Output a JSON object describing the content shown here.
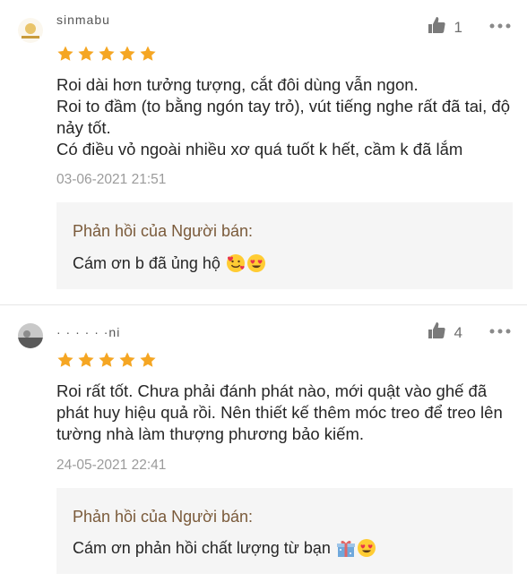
{
  "colors": {
    "star": "#f5a623",
    "reply_title": "#7a5a3a",
    "reply_bg": "#f5f5f5"
  },
  "reviews": [
    {
      "username": "sinmabu",
      "likes": "1",
      "rating": 5,
      "text": "Roi dài hơn tưởng tượng, cắt đôi dùng vẫn ngon.\nRoi to đầm (to bằng ngón tay trỏ), vút tiếng nghe rất đã tai, độ nảy tốt.\nCó điều vỏ ngoài nhiều xơ quá tuốt k hết, cầm k đã lắm",
      "timestamp": "03-06-2021 21:51",
      "reply_title": "Phản hồi của Người bán:",
      "reply_text": "Cám ơn b đã ủng hộ",
      "reply_emojis": [
        "smiling-face-with-hearts",
        "heart-eyes"
      ]
    },
    {
      "username": "· · · · · ·ni",
      "likes": "4",
      "rating": 5,
      "text": "Roi rất tốt. Chưa phải đánh phát nào, mới quật vào ghế đã phát huy hiệu quả rồi. Nên thiết kế thêm móc treo để treo lên tường nhà làm thượng phương bảo kiếm.",
      "timestamp": "24-05-2021 22:41",
      "reply_title": "Phản hồi của Người bán:",
      "reply_text": "Cám ơn phản hồi chất lượng từ bạn",
      "reply_emojis": [
        "gift",
        "heart-eyes"
      ]
    }
  ],
  "icons": {
    "like": "thumbs-up-icon",
    "more": "more-dots-icon",
    "star": "star-icon"
  }
}
